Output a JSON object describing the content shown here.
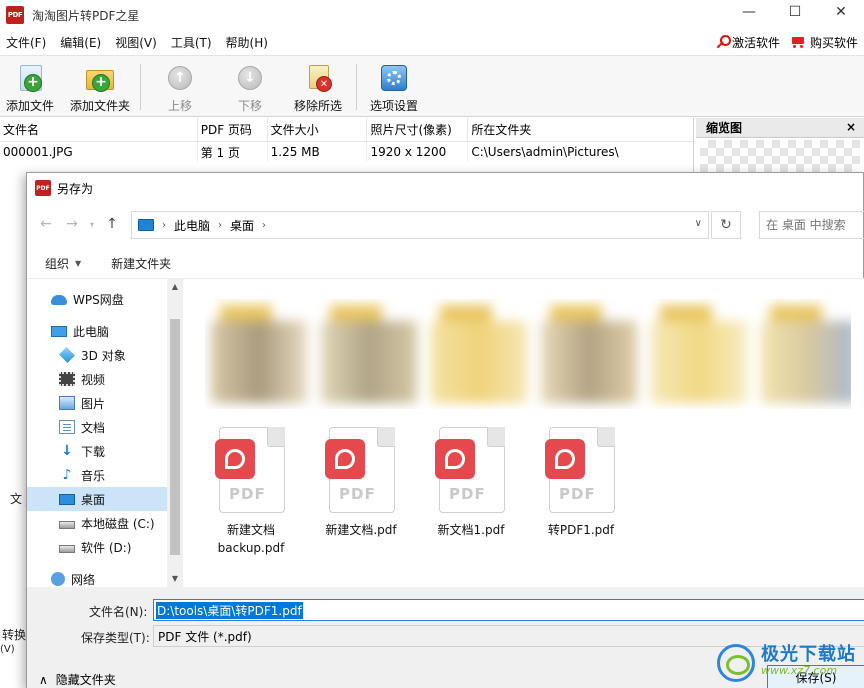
{
  "app": {
    "title": "淘淘图片转PDF之星",
    "logo_text": "PDF",
    "window_buttons": [
      "—",
      "☐",
      "✕"
    ]
  },
  "menu": {
    "items": [
      "文件(F)",
      "编辑(E)",
      "视图(V)",
      "工具(T)",
      "帮助(H)"
    ],
    "activate": "激活软件",
    "buy": "购买软件"
  },
  "toolbar": {
    "add_file": "添加文件",
    "add_folder": "添加文件夹",
    "move_up": "上移",
    "move_down": "下移",
    "remove_selected": "移除所选",
    "options": "选项设置"
  },
  "file_table": {
    "headers": [
      "文件名",
      "PDF 页码",
      "文件大小",
      "照片尺寸(像素)",
      "所在文件夹"
    ],
    "rows": [
      [
        "000001.JPG",
        "第 1 页",
        "1.25 MB",
        "1920 x 1200",
        "C:\\Users\\admin\\Pictures\\"
      ]
    ]
  },
  "left_stubs": {
    "a": "文",
    "b": "转换",
    "c": "(V)"
  },
  "preview": {
    "title": "缩览图",
    "close": "×"
  },
  "dialog": {
    "title": "另存为",
    "breadcrumb": [
      "此电脑",
      "桌面"
    ],
    "search_placeholder": "在 桌面 中搜索",
    "organize": "组织",
    "new_folder": "新建文件夹",
    "nav_items": [
      "WPS网盘",
      "此电脑",
      "3D 对象",
      "视频",
      "图片",
      "文档",
      "下载",
      "音乐",
      "桌面",
      "本地磁盘 (C:)",
      "软件 (D:)",
      "网络"
    ],
    "files": [
      {
        "line1": "新建文档",
        "line2": "backup.pdf"
      },
      {
        "line1": "新建文档.pdf",
        "line2": ""
      },
      {
        "line1": "新文档1.pdf",
        "line2": ""
      },
      {
        "line1": "转PDF1.pdf",
        "line2": ""
      }
    ],
    "pdf_word": "PDF",
    "filename_label": "文件名(N):",
    "filename_value": "D:\\tools\\桌面\\转PDF1.pdf",
    "filetype_label": "保存类型(T):",
    "filetype_value": "PDF 文件 (*.pdf)",
    "hide_folders": "隐藏文件夹",
    "save": "保存(S)"
  },
  "watermark": {
    "main": "极光下载站",
    "sub": "www.xz7.com"
  }
}
